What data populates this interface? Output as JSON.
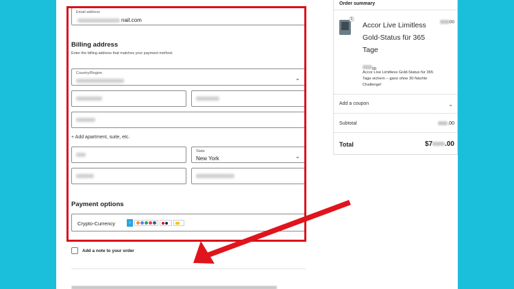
{
  "checkout": {
    "email": {
      "label": "Email address",
      "value": "nail.com"
    },
    "billing": {
      "title": "Billing address",
      "subtitle": "Enter the billing address that matches your payment method.",
      "country_label": "Country/Region",
      "add_apartment": "+ Add apartment, suite, etc.",
      "state_label": "State",
      "state_value": "New York"
    },
    "payment": {
      "title": "Payment options",
      "method": "Crypto-Currency"
    },
    "note_label": "Add a note to your order"
  },
  "order_summary": {
    "title": "Order summary",
    "quantity": "1",
    "product_name": "Accor Live Limitless Gold-Status für 365 Tage",
    "product_price": "00",
    "product_description": "Accor Live Limitless Gold-Status für 365 Tage sichern – ganz ohne 30 Nächte Challenge!",
    "coupon_label": "Add a coupon",
    "subtotal_label": "Subtotal",
    "subtotal_value": ".00",
    "total_label": "Total",
    "total_value": ".00",
    "total_prefix": "$7"
  },
  "icons": {
    "chevron": "chevron-down-icon",
    "crypto_arrow": "chevron-left-icon"
  },
  "colors": {
    "background": "#1bbfdc",
    "highlight_box": "#d9101a",
    "annotation_arrow": "#e0141c"
  }
}
